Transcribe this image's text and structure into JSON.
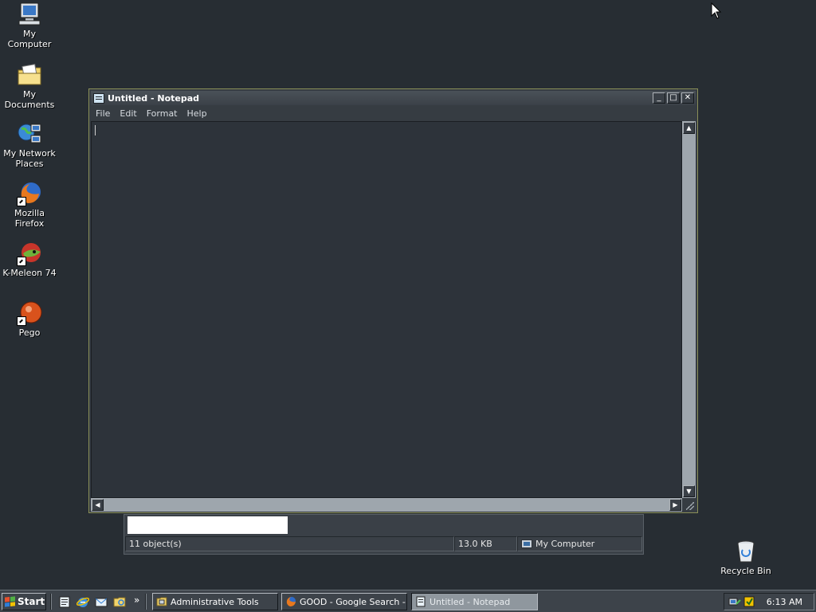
{
  "desktop": {
    "icons": [
      {
        "label": "My Computer",
        "icon": "my-computer-icon"
      },
      {
        "label": "My Documents",
        "icon": "my-documents-icon"
      },
      {
        "label": "My Network Places",
        "icon": "network-places-icon"
      },
      {
        "label": "Mozilla Firefox",
        "icon": "firefox-icon"
      },
      {
        "label": "K-Meleon 74",
        "icon": "k-meleon-icon"
      },
      {
        "label": "Pego",
        "icon": "pego-icon"
      }
    ],
    "recycle_bin": {
      "label": "Recycle Bin",
      "icon": "recycle-bin-icon"
    }
  },
  "background_window": {
    "status": {
      "objects": "11 object(s)",
      "size": "13.0 KB",
      "location": "My Computer"
    }
  },
  "notepad": {
    "title": "Untitled - Notepad",
    "menu": [
      "File",
      "Edit",
      "Format",
      "Help"
    ],
    "content": "",
    "controls": {
      "minimize": "_",
      "maximize": "□",
      "close": "✕"
    }
  },
  "taskbar": {
    "start_label": "Start",
    "quick_launch": [
      "notepad-icon",
      "ie-icon",
      "outlook-icon",
      "folder-icon"
    ],
    "overflow": "»",
    "tasks": [
      {
        "label": "Administrative Tools",
        "active": false
      },
      {
        "label": "GOOD - Google Search - ...",
        "active": false
      },
      {
        "label": "Untitled - Notepad",
        "active": true
      }
    ],
    "clock": "6:13 AM"
  },
  "colors": {
    "desktop": "#272d33",
    "window_border": "#8a8f58",
    "active_task": "#8f979e"
  }
}
